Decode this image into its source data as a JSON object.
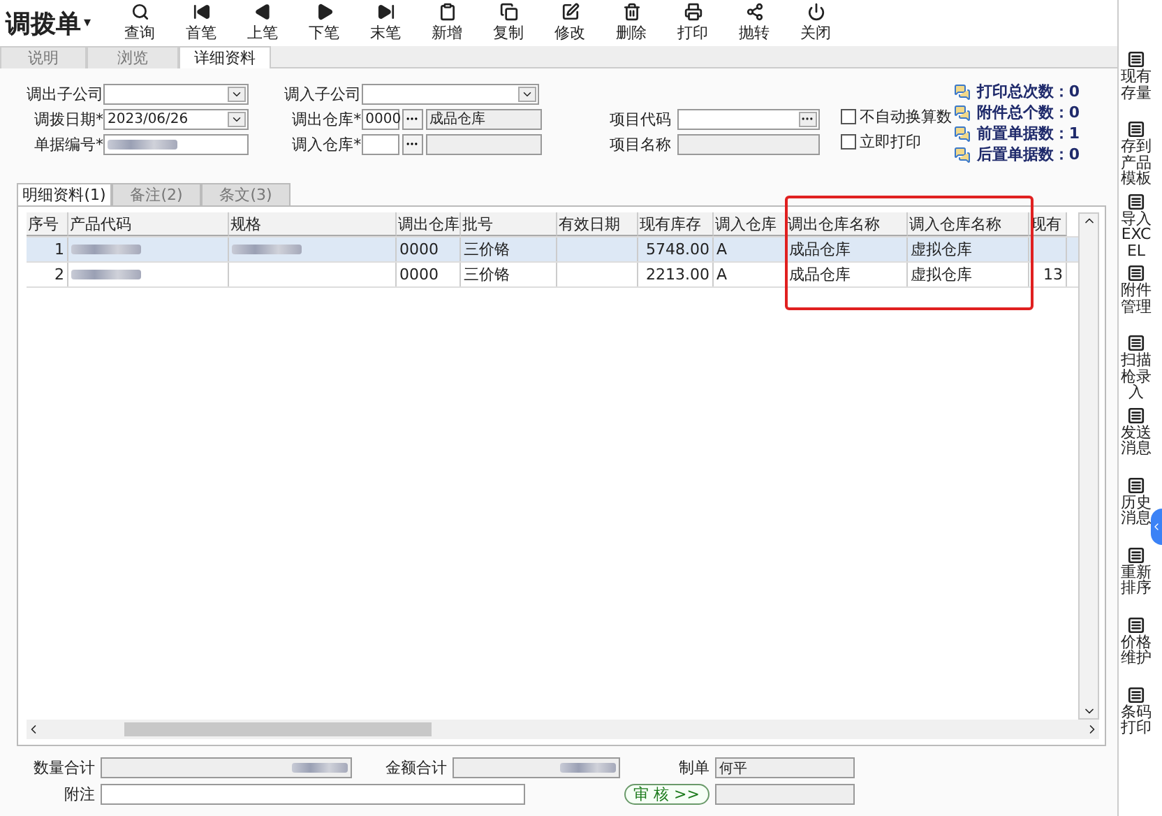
{
  "title": "调拨单",
  "title_caret": "▾",
  "toolbar": [
    "查询",
    "首笔",
    "上笔",
    "下笔",
    "末笔",
    "新增",
    "复制",
    "修改",
    "删除",
    "打印",
    "抛转",
    "关闭"
  ],
  "tabs": [
    {
      "label": "说明",
      "selected": false
    },
    {
      "label": "浏览",
      "selected": false
    },
    {
      "label": "详细资料",
      "selected": true
    }
  ],
  "form": {
    "out_company": {
      "label": "调出子公司"
    },
    "in_company": {
      "label": "调入子公司"
    },
    "date": {
      "label": "调拨日期*",
      "value": "2023/06/26"
    },
    "out_warehouse": {
      "label": "调出仓库*",
      "code": "0000",
      "name": "成品仓库"
    },
    "doc_no": {
      "label": "单据编号*",
      "blurred": true
    },
    "in_warehouse": {
      "label": "调入仓库*"
    },
    "project_code": {
      "label": "项目代码"
    },
    "project_name": {
      "label": "项目名称"
    },
    "checkboxes": [
      {
        "label": "不自动换算数",
        "checked": false
      },
      {
        "label": "立即打印",
        "checked": false
      }
    ],
    "counts": [
      "打印总次数：0",
      "附件总个数：0",
      "前置单据数：1",
      "后置单据数：0"
    ]
  },
  "detail_tabs": [
    {
      "label": "明细资料(1)",
      "selected": true
    },
    {
      "label": "备注(2)",
      "selected": false
    },
    {
      "label": "条文(3)",
      "selected": false
    }
  ],
  "table": {
    "columns": [
      "序号",
      "产品代码",
      "规格",
      "调出仓库",
      "批号",
      "有效日期",
      "现有库存",
      "调入仓库",
      "调出仓库名称",
      "调入仓库名称",
      "现有"
    ],
    "rows": [
      {
        "selected": true,
        "cells": [
          "1",
          {
            "blurred": true
          },
          {
            "blurred": true
          },
          "0000",
          "三价铬",
          null,
          "5748.00",
          "A",
          "成品仓库",
          "虚拟仓库",
          null
        ]
      },
      {
        "selected": false,
        "cells": [
          "2",
          {
            "blurred": true
          },
          null,
          "0000",
          "三价铬",
          null,
          "2213.00",
          "A",
          "成品仓库",
          "虚拟仓库",
          "13"
        ]
      }
    ]
  },
  "footer": {
    "qty_total": {
      "label": "数量合计",
      "blurred": true
    },
    "amount_total": {
      "label": "金额合计",
      "blurred": true
    },
    "maker": {
      "label": "制单",
      "value": "何平"
    },
    "note": {
      "label": "附注"
    },
    "audit_button": "审 核 >>"
  },
  "sidebar": [
    "现有存量",
    "存到产品模板",
    "导入EXCEL",
    "附件管理",
    "扫描枪录入",
    "发送消息",
    "历史消息",
    "重新排序",
    "价格维护",
    "条码打印"
  ]
}
